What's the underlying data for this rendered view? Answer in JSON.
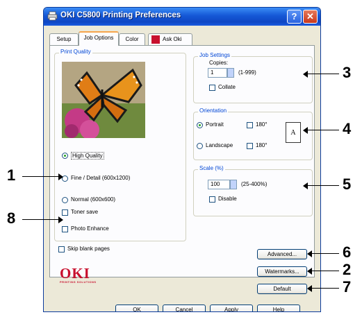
{
  "window": {
    "title": "OKI C5800 Printing Preferences",
    "help_label": "?",
    "close_label": "✕"
  },
  "tabs": [
    {
      "label": "Setup",
      "active": false
    },
    {
      "label": "Job Options",
      "active": true
    },
    {
      "label": "Color",
      "active": false
    },
    {
      "label": "Ask Oki",
      "active": false
    }
  ],
  "print_quality": {
    "title": "Print Quality",
    "options": [
      {
        "label": "High Quality",
        "selected": true
      },
      {
        "label": "Fine / Detail (600x1200)",
        "selected": false
      },
      {
        "label": "Normal (600x600)",
        "selected": false
      }
    ],
    "toner_save": "Toner save",
    "photo_enhance": "Photo Enhance"
  },
  "job_settings": {
    "title": "Job Settings",
    "copies_label": "Copies:",
    "copies_value": "1",
    "copies_range": "(1-999)",
    "collate": "Collate"
  },
  "orientation": {
    "title": "Orientation",
    "portrait": "Portrait",
    "landscape": "Landscape",
    "rotate_portrait": "180°",
    "rotate_landscape": "180°",
    "preview_letter": "A",
    "portrait_selected": true
  },
  "scale": {
    "title": "Scale (%)",
    "value": "100",
    "range": "(25-400%)",
    "disable": "Disable"
  },
  "skip_blank": "Skip blank pages",
  "logo": {
    "text": "OKI",
    "tagline": "PRINTING SOLUTIONS",
    "color": "#c8102e"
  },
  "buttons": {
    "advanced": "Advanced...",
    "watermarks": "Watermarks...",
    "default": "Default",
    "ok": "OK",
    "cancel": "Cancel",
    "apply": "Apply",
    "help": "Help"
  },
  "callouts": [
    "1",
    "2",
    "3",
    "4",
    "5",
    "6",
    "7",
    "8"
  ]
}
